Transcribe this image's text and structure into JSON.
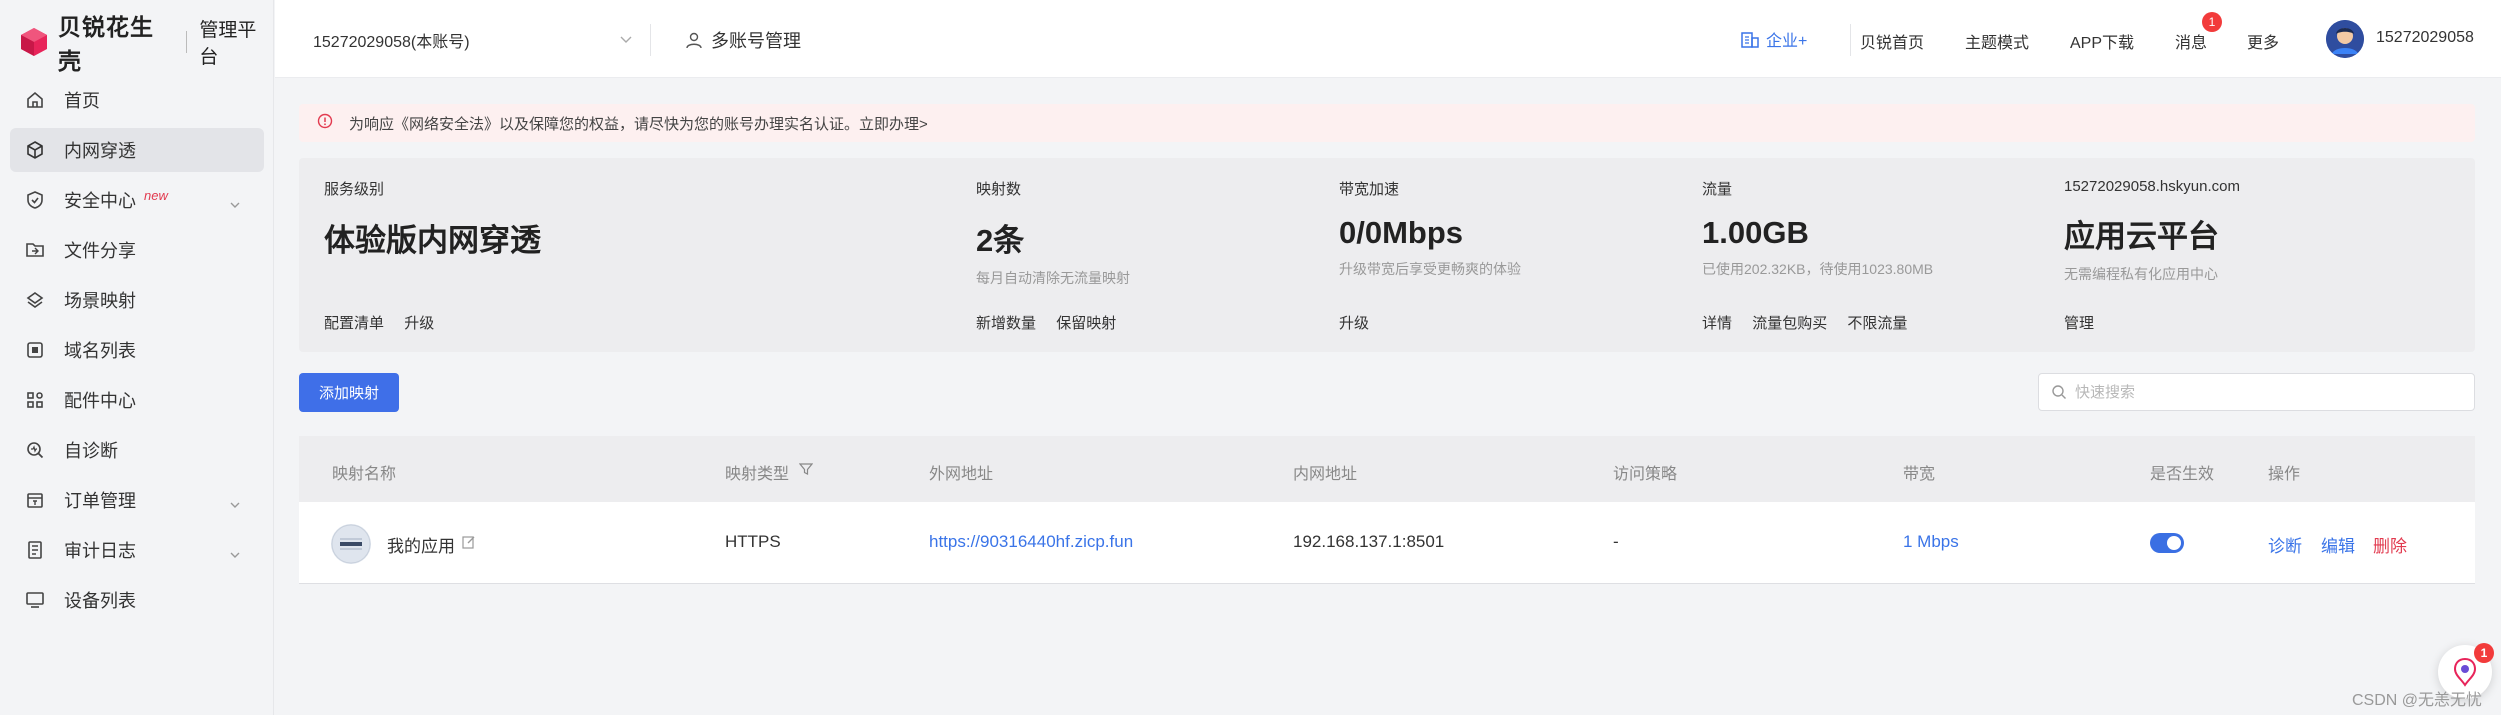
{
  "brand": {
    "name": "贝锐花生壳",
    "platform": "管理平台"
  },
  "sidebar": {
    "items": [
      {
        "label": "首页",
        "icon": "home-icon"
      },
      {
        "label": "内网穿透",
        "icon": "cube-icon"
      },
      {
        "label": "安全中心",
        "icon": "shield-icon",
        "tag": "new"
      },
      {
        "label": "文件分享",
        "icon": "folder-share-icon"
      },
      {
        "label": "场景映射",
        "icon": "layers-icon"
      },
      {
        "label": "域名列表",
        "icon": "domain-icon"
      },
      {
        "label": "配件中心",
        "icon": "grid-icon"
      },
      {
        "label": "自诊断",
        "icon": "diagnose-icon"
      },
      {
        "label": "订单管理",
        "icon": "order-icon"
      },
      {
        "label": "审计日志",
        "icon": "log-icon"
      },
      {
        "label": "设备列表",
        "icon": "monitor-icon"
      }
    ]
  },
  "topbar": {
    "account": "15272029058(本账号)",
    "multi_account": "多账号管理",
    "enterprise": "企业+",
    "links": [
      "贝锐首页",
      "主题模式",
      "APP下载",
      "消息",
      "更多"
    ],
    "message_badge": "1",
    "username": "15272029058"
  },
  "alert": {
    "text": "为响应《网络安全法》以及保障您的权益，请尽快为您的账号办理实名认证。立即办理>"
  },
  "stats": [
    {
      "label": "服务级别",
      "value": "体验版内网穿透",
      "sub": "",
      "actions": [
        "配置清单",
        "升级"
      ]
    },
    {
      "label": "映射数",
      "value": "2条",
      "sub": "每月自动清除无流量映射",
      "actions": [
        "新增数量",
        "保留映射"
      ]
    },
    {
      "label": "带宽加速",
      "value": "0/0Mbps",
      "sub": "升级带宽后享受更畅爽的体验",
      "actions": [
        "升级"
      ]
    },
    {
      "label": "流量",
      "value": "1.00GB",
      "sub": "已使用202.32KB，待使用1023.80MB",
      "actions": [
        "详情",
        "流量包购买",
        "不限流量"
      ]
    },
    {
      "label": "15272029058.hskyun.com",
      "value": "应用云平台",
      "sub": "无需编程私有化应用中心",
      "actions": [
        "管理"
      ]
    }
  ],
  "toolbar": {
    "add_label": "添加映射",
    "search_placeholder": "快速搜索"
  },
  "table": {
    "headers": [
      "映射名称",
      "映射类型",
      "外网地址",
      "内网地址",
      "访问策略",
      "带宽",
      "是否生效",
      "操作"
    ],
    "rows": [
      {
        "name": "我的应用",
        "type": "HTTPS",
        "external": "https://90316440hf.zicp.fun",
        "internal": "192.168.137.1:8501",
        "policy": "-",
        "bandwidth": "1 Mbps",
        "enabled": true,
        "actions": [
          "诊断",
          "编辑",
          "删除"
        ]
      }
    ]
  },
  "float_badge": "1",
  "watermark": "CSDN @无恙无忧",
  "colors": {
    "accent": "#3a74e8",
    "danger": "#e23a4f",
    "brand": "#e8245a"
  }
}
